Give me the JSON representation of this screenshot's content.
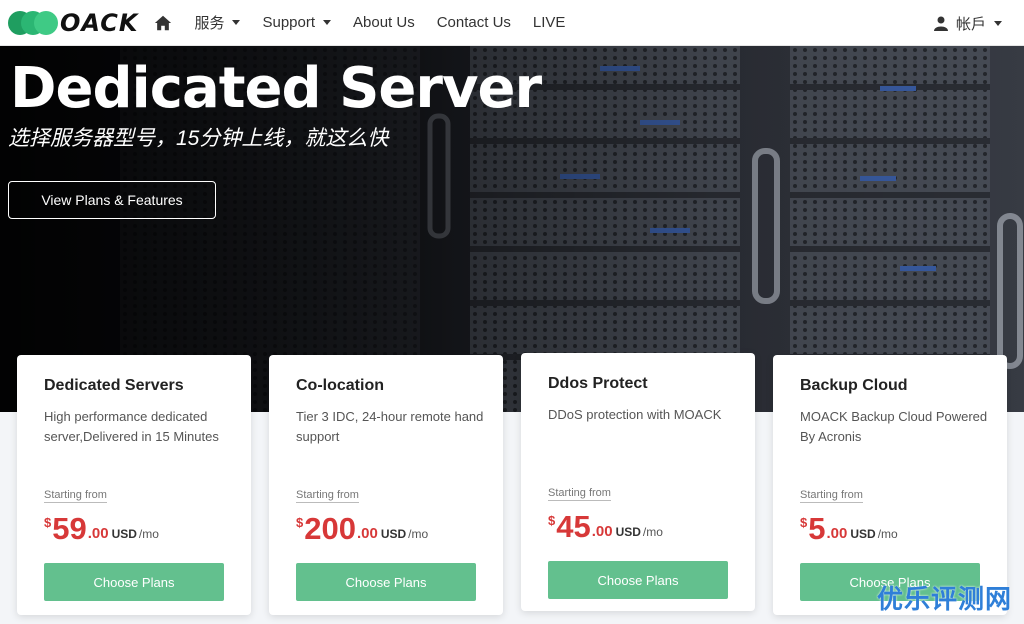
{
  "nav": {
    "logo_text": "OACK",
    "items": [
      {
        "label": "服务",
        "dropdown": true
      },
      {
        "label": "Support",
        "dropdown": true
      },
      {
        "label": "About Us",
        "dropdown": false
      },
      {
        "label": "Contact Us",
        "dropdown": false
      },
      {
        "label": "LIVE",
        "dropdown": false
      }
    ],
    "account_label": "帐戶"
  },
  "hero": {
    "title": "Dedicated Server",
    "subtitle": "选择服务器型号，15分钟上线，就这么快",
    "button_label": "View Plans & Features"
  },
  "cards": [
    {
      "title": "Dedicated Servers",
      "desc": "High performance dedicated server,Delivered in 15 Minutes",
      "starting": "Starting from",
      "currency": "$",
      "price_int": "59",
      "price_dec": ".00",
      "unit": "USD",
      "per": "/mo",
      "button": "Choose Plans"
    },
    {
      "title": "Co-location",
      "desc": "Tier 3 IDC, 24-hour remote hand support",
      "starting": "Starting from",
      "currency": "$",
      "price_int": "200",
      "price_dec": ".00",
      "unit": "USD",
      "per": "/mo",
      "button": "Choose Plans"
    },
    {
      "title": "Ddos Protect",
      "desc": "DDoS protection with MOACK",
      "starting": "Starting from",
      "currency": "$",
      "price_int": "45",
      "price_dec": ".00",
      "unit": "USD",
      "per": "/mo",
      "button": "Choose Plans"
    },
    {
      "title": "Backup Cloud",
      "desc": "MOACK Backup Cloud Powered By Acronis",
      "starting": "Starting from",
      "currency": "$",
      "price_int": "5",
      "price_dec": ".00",
      "unit": "USD",
      "per": "/mo",
      "button": "Choose Plans"
    }
  ],
  "watermark": "优乐评测网",
  "colors": {
    "accent_green": "#63c08e",
    "price_red": "#d73838",
    "logo_green": "#2bb673"
  },
  "icons": {
    "home": "home-icon",
    "account": "user-icon"
  }
}
